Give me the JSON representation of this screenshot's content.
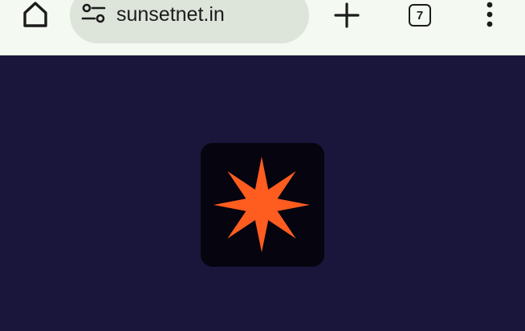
{
  "toolbar": {
    "home_icon": "home-icon",
    "site_settings_icon": "tune-icon",
    "url": "sunsetnet.in",
    "new_tab_icon": "plus-icon",
    "tab_count": "7",
    "menu_icon": "more-vert-icon"
  },
  "page": {
    "background_color": "#1a153a",
    "logo": {
      "icon": "eight-point-star-icon",
      "tile_color": "#05040f",
      "star_color": "#ff5c1f"
    }
  }
}
